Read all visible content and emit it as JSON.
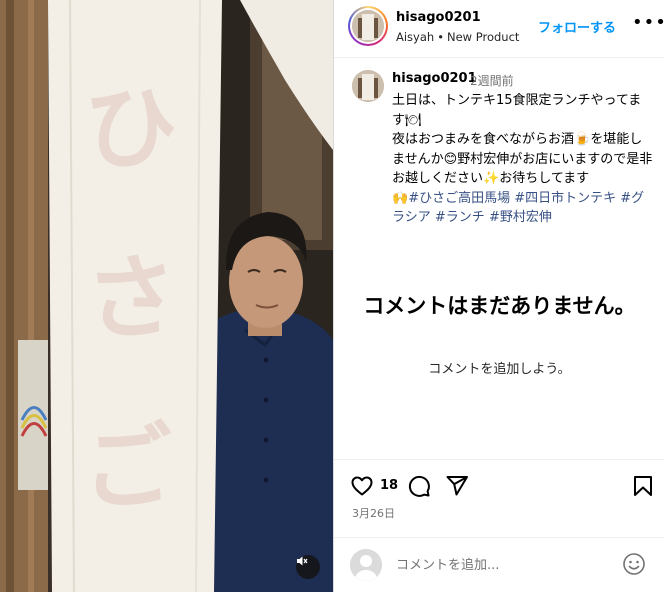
{
  "header": {
    "username": "hisago0201",
    "subtitle_left": "Aisyah",
    "subtitle_separator": "•",
    "subtitle_right": "New Product",
    "follow_label": "フォローする",
    "more_label": "•••"
  },
  "media": {
    "noren_text": "ひさご",
    "mute_icon": "speaker-muted-icon"
  },
  "caption": {
    "username": "hisago0201",
    "time": "2週間前",
    "line1": "土日は、トンテキ15食限定ランチやってます",
    "line2": "夜はおつまみを食べながらお酒",
    "line2b": "を堪能しませんか",
    "line2c": "野村宏伸がお店にいますので是非お越しください",
    "line2d": "お待ちしてます",
    "hashtags": [
      "#ひさご高田馬場",
      "#四日市トンテキ",
      "#グラシア",
      "#ランチ",
      "#野村宏伸"
    ],
    "emoji_plate": "🍽",
    "emoji_beer": "🍺",
    "emoji_smile": "😊",
    "emoji_sparkle": "✨",
    "emoji_hands": "🙌"
  },
  "comments": {
    "empty_title": "コメントはまだありません。",
    "empty_sub": "コメントを追加しよう。"
  },
  "actions": {
    "like_count": "18",
    "date": "3月26日"
  },
  "comment_input": {
    "placeholder": "コメントを追加..."
  },
  "colors": {
    "link": "#0095f6",
    "hashtag": "#385185",
    "muted_text": "#737373"
  }
}
